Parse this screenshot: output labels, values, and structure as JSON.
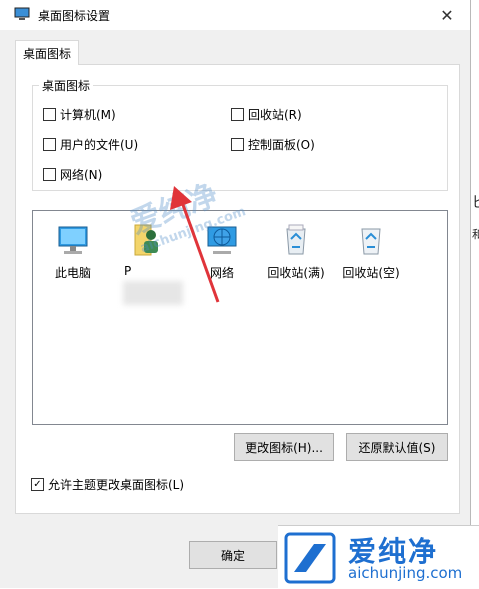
{
  "window": {
    "title": "桌面图标设置",
    "close": "✕"
  },
  "tabs": [
    {
      "label": "桌面图标"
    }
  ],
  "group": {
    "title": "桌面图标",
    "checkboxes": [
      {
        "label": "计算机(M)",
        "checked": false
      },
      {
        "label": "回收站(R)",
        "checked": false
      },
      {
        "label": "用户的文件(U)",
        "checked": false
      },
      {
        "label": "控制面板(O)",
        "checked": false
      },
      {
        "label": "网络(N)",
        "checked": false
      }
    ]
  },
  "icons": [
    {
      "label": "此电脑",
      "icon": "computer-icon"
    },
    {
      "label": "P",
      "icon": "user-folder-icon"
    },
    {
      "label": "网络",
      "icon": "network-icon"
    },
    {
      "label": "回收站(满)",
      "icon": "recycle-bin-full-icon"
    },
    {
      "label": "回收站(空)",
      "icon": "recycle-bin-empty-icon"
    }
  ],
  "buttons": {
    "change_icon": "更改图标(H)...",
    "restore_default": "还原默认值(S)",
    "ok": "确定"
  },
  "allow_themes": {
    "label": "允许主题更改桌面图标(L)",
    "checked": true,
    "mark": "✓"
  },
  "watermark": {
    "brand": "爱纯净",
    "url": "aichunjing.com"
  },
  "background_fragments": [
    "匕",
    "和"
  ],
  "colors": {
    "accent": "#1e6fd0",
    "arrow": "#e0343a"
  }
}
